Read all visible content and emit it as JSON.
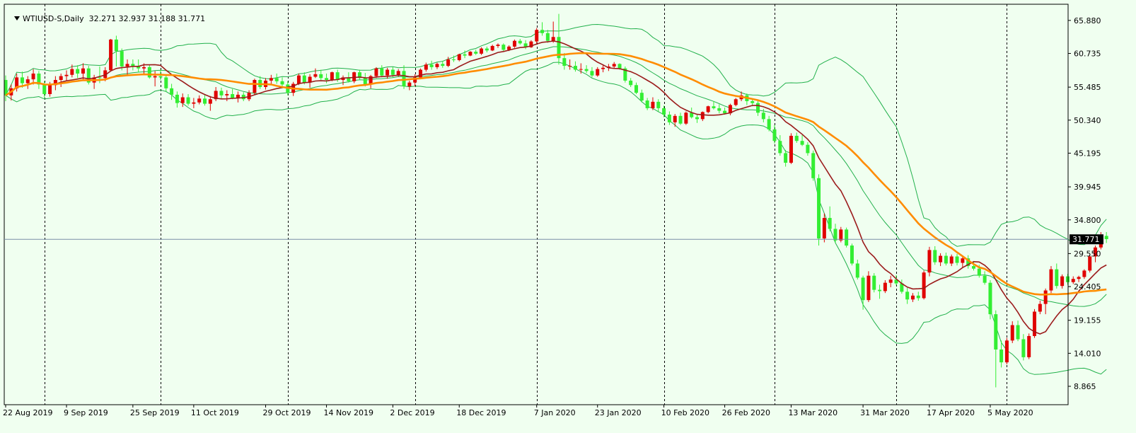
{
  "chart_data": {
    "type": "candlestick",
    "title": "WTIUSD-S,Daily",
    "ohlc_label": "32.271 32.937 31.188 31.771",
    "last_price": "31.771",
    "price_ticks": [
      "65.880",
      "60.735",
      "55.485",
      "50.340",
      "45.195",
      "39.945",
      "34.800",
      "29.550",
      "24.405",
      "19.155",
      "14.010",
      "8.865"
    ],
    "date_labels": [
      "22 Aug 2019",
      "9 Sep 2019",
      "25 Sep 2019",
      "11 Oct 2019",
      "29 Oct 2019",
      "14 Nov 2019",
      "2 Dec 2019",
      "18 Dec 2019",
      "7 Jan 2020",
      "23 Jan 2020",
      "10 Feb 2020",
      "26 Feb 2020",
      "13 Mar 2020",
      "31 Mar 2020",
      "17 Apr 2020",
      "5 May 2020"
    ],
    "period_separators": [
      "Sep 2019",
      "Oct 2019",
      "Nov 2019",
      "Dec 2019",
      "Jan 2020",
      "Feb 2020",
      "Mar 2020",
      "Apr 2020",
      "May 2020"
    ],
    "ylim": [
      6.0,
      68.4
    ],
    "indicators": [
      {
        "name": "Bollinger Bands",
        "color": "#22b14c"
      },
      {
        "name": "MA fast",
        "color": "#9b1b1b"
      },
      {
        "name": "MA slow",
        "color": "#ff8c00"
      }
    ],
    "colors": {
      "bull": "#e00000",
      "bear": "#33ee33",
      "grid": "#000000",
      "background": "#f0fff0"
    },
    "candles": [
      [
        56.6,
        57.3,
        53.3,
        54.2
      ],
      [
        54.2,
        55.9,
        53.4,
        55.3
      ],
      [
        55.3,
        57.6,
        54.8,
        57.0
      ],
      [
        57.0,
        57.9,
        55.4,
        56.1
      ],
      [
        56.1,
        57.2,
        55.2,
        56.7
      ],
      [
        56.7,
        58.3,
        55.9,
        57.6
      ],
      [
        57.6,
        58.0,
        55.2,
        55.9
      ],
      [
        55.9,
        56.4,
        53.8,
        54.4
      ],
      [
        54.4,
        56.3,
        54.0,
        55.8
      ],
      [
        55.8,
        57.2,
        55.0,
        56.6
      ],
      [
        56.6,
        57.6,
        55.5,
        57.2
      ],
      [
        57.2,
        58.1,
        56.4,
        57.4
      ],
      [
        57.4,
        59.0,
        57.0,
        58.3
      ],
      [
        58.3,
        58.9,
        56.9,
        57.6
      ],
      [
        57.6,
        59.2,
        56.5,
        58.4
      ],
      [
        58.4,
        58.8,
        55.9,
        56.2
      ],
      [
        56.2,
        57.4,
        55.2,
        57.0
      ],
      [
        57.0,
        58.7,
        56.1,
        56.9
      ],
      [
        56.9,
        58.6,
        56.4,
        58.1
      ],
      [
        58.1,
        63.0,
        58.0,
        62.9
      ],
      [
        62.9,
        63.5,
        58.7,
        61.1
      ],
      [
        61.1,
        61.5,
        58.1,
        58.7
      ],
      [
        58.7,
        59.8,
        57.2,
        59.1
      ],
      [
        59.1,
        59.8,
        58.1,
        58.8
      ],
      [
        58.8,
        59.8,
        57.8,
        58.4
      ],
      [
        58.4,
        59.2,
        57.4,
        58.6
      ],
      [
        58.6,
        59.0,
        56.8,
        57.0
      ],
      [
        57.0,
        58.0,
        55.6,
        57.2
      ],
      [
        57.2,
        58.2,
        56.6,
        57.0
      ],
      [
        57.0,
        57.5,
        54.8,
        55.3
      ],
      [
        55.3,
        56.0,
        53.5,
        54.3
      ],
      [
        54.3,
        54.8,
        52.3,
        53.0
      ],
      [
        53.0,
        54.5,
        52.4,
        53.9
      ],
      [
        53.9,
        54.4,
        52.6,
        52.9
      ],
      [
        52.9,
        53.8,
        52.2,
        53.1
      ],
      [
        53.1,
        54.2,
        52.8,
        53.7
      ],
      [
        53.7,
        54.3,
        52.6,
        52.9
      ],
      [
        52.9,
        54.1,
        51.8,
        53.6
      ],
      [
        53.6,
        55.5,
        53.3,
        54.9
      ],
      [
        54.9,
        55.4,
        53.7,
        54.2
      ],
      [
        54.2,
        55.0,
        53.3,
        54.4
      ],
      [
        54.4,
        55.2,
        53.6,
        53.8
      ],
      [
        53.8,
        54.8,
        53.1,
        54.3
      ],
      [
        54.3,
        54.7,
        53.3,
        53.6
      ],
      [
        53.6,
        55.0,
        53.3,
        54.6
      ],
      [
        54.6,
        56.8,
        54.3,
        56.6
      ],
      [
        56.6,
        57.2,
        55.2,
        55.5
      ],
      [
        55.5,
        56.9,
        55.1,
        56.5
      ],
      [
        56.5,
        57.4,
        55.8,
        56.9
      ],
      [
        56.9,
        57.6,
        56.0,
        56.4
      ],
      [
        56.4,
        57.0,
        55.3,
        55.9
      ],
      [
        55.9,
        56.4,
        54.2,
        54.6
      ],
      [
        54.6,
        56.3,
        54.1,
        56.0
      ],
      [
        56.0,
        57.6,
        55.8,
        57.3
      ],
      [
        57.3,
        57.8,
        55.9,
        56.2
      ],
      [
        56.2,
        57.5,
        55.4,
        57.1
      ],
      [
        57.1,
        58.4,
        56.9,
        57.5
      ],
      [
        57.5,
        58.2,
        56.6,
        56.9
      ],
      [
        56.9,
        57.6,
        56.1,
        56.6
      ],
      [
        56.6,
        57.9,
        56.4,
        57.8
      ],
      [
        57.8,
        58.2,
        56.3,
        56.6
      ],
      [
        56.6,
        57.3,
        55.8,
        57.0
      ],
      [
        57.0,
        57.8,
        56.2,
        56.4
      ],
      [
        56.4,
        57.9,
        56.1,
        57.8
      ],
      [
        57.8,
        58.2,
        56.6,
        56.9
      ],
      [
        56.9,
        57.7,
        55.6,
        55.9
      ],
      [
        55.9,
        57.4,
        55.3,
        57.2
      ],
      [
        57.2,
        58.6,
        56.9,
        58.4
      ],
      [
        58.4,
        58.9,
        57.0,
        57.3
      ],
      [
        57.3,
        58.5,
        56.8,
        58.2
      ],
      [
        58.2,
        58.6,
        57.0,
        57.4
      ],
      [
        57.4,
        58.3,
        57.1,
        58.0
      ],
      [
        58.0,
        58.9,
        55.2,
        55.6
      ],
      [
        55.6,
        56.5,
        55.0,
        56.2
      ],
      [
        56.2,
        57.5,
        55.6,
        57.0
      ],
      [
        57.0,
        58.4,
        56.8,
        58.2
      ],
      [
        58.2,
        59.3,
        57.9,
        59.0
      ],
      [
        59.0,
        59.6,
        58.2,
        58.6
      ],
      [
        58.6,
        59.3,
        58.3,
        59.1
      ],
      [
        59.1,
        59.6,
        58.5,
        58.8
      ],
      [
        58.8,
        60.2,
        58.6,
        59.8
      ],
      [
        59.8,
        60.4,
        59.4,
        59.7
      ],
      [
        59.7,
        60.7,
        59.5,
        60.6
      ],
      [
        60.6,
        61.2,
        60.0,
        60.4
      ],
      [
        60.4,
        61.1,
        60.3,
        61.0
      ],
      [
        61.0,
        61.3,
        60.5,
        60.7
      ],
      [
        60.7,
        61.7,
        60.5,
        61.5
      ],
      [
        61.5,
        61.8,
        60.9,
        61.2
      ],
      [
        61.2,
        62.1,
        61.1,
        61.9
      ],
      [
        61.9,
        62.3,
        61.6,
        62.1
      ],
      [
        62.1,
        62.3,
        61.1,
        61.3
      ],
      [
        61.3,
        62.0,
        61.1,
        61.8
      ],
      [
        61.8,
        62.9,
        61.6,
        62.7
      ],
      [
        62.7,
        63.0,
        62.1,
        62.3
      ],
      [
        62.3,
        62.8,
        61.4,
        61.7
      ],
      [
        61.7,
        62.8,
        61.6,
        62.6
      ],
      [
        62.6,
        64.7,
        62.1,
        64.4
      ],
      [
        64.4,
        65.6,
        63.5,
        63.9
      ],
      [
        63.9,
        64.4,
        62.4,
        62.7
      ],
      [
        62.7,
        65.7,
        62.4,
        63.3
      ],
      [
        63.3,
        66.9,
        59.0,
        60.0
      ],
      [
        60.0,
        60.8,
        58.2,
        58.8
      ],
      [
        58.8,
        59.8,
        58.2,
        58.8
      ],
      [
        58.8,
        59.5,
        57.9,
        58.2
      ],
      [
        58.2,
        59.2,
        57.6,
        58.3
      ],
      [
        58.3,
        58.9,
        57.7,
        58.0
      ],
      [
        58.0,
        58.6,
        57.0,
        57.3
      ],
      [
        57.3,
        58.6,
        57.1,
        58.3
      ],
      [
        58.3,
        59.0,
        57.8,
        58.5
      ],
      [
        58.5,
        59.1,
        58.0,
        58.7
      ],
      [
        58.7,
        59.4,
        58.4,
        59.1
      ],
      [
        59.1,
        59.2,
        58.2,
        58.4
      ],
      [
        58.4,
        58.7,
        56.2,
        56.5
      ],
      [
        56.5,
        56.9,
        55.5,
        55.8
      ],
      [
        55.8,
        56.2,
        54.4,
        54.6
      ],
      [
        54.6,
        55.1,
        53.1,
        53.4
      ],
      [
        53.4,
        53.8,
        51.9,
        52.2
      ],
      [
        52.2,
        53.9,
        51.9,
        53.2
      ],
      [
        53.2,
        53.6,
        51.7,
        52.2
      ],
      [
        52.2,
        52.6,
        50.8,
        51.2
      ],
      [
        51.2,
        51.7,
        49.6,
        50.0
      ],
      [
        50.0,
        51.3,
        49.3,
        51.0
      ],
      [
        51.0,
        51.5,
        49.6,
        49.8
      ],
      [
        49.8,
        51.7,
        49.6,
        51.5
      ],
      [
        51.5,
        52.3,
        50.6,
        50.8
      ],
      [
        50.8,
        51.2,
        49.9,
        50.5
      ],
      [
        50.5,
        51.7,
        50.2,
        51.6
      ],
      [
        51.6,
        52.6,
        51.4,
        52.5
      ],
      [
        52.5,
        53.3,
        52.0,
        52.2
      ],
      [
        52.2,
        52.8,
        51.4,
        51.8
      ],
      [
        51.8,
        52.3,
        51.2,
        51.4
      ],
      [
        51.4,
        52.9,
        51.1,
        52.7
      ],
      [
        52.7,
        53.8,
        52.5,
        53.6
      ],
      [
        53.6,
        54.8,
        53.3,
        54.2
      ],
      [
        54.2,
        54.5,
        52.7,
        53.3
      ],
      [
        53.3,
        53.7,
        52.5,
        53.0
      ],
      [
        53.0,
        53.3,
        51.0,
        51.5
      ],
      [
        51.5,
        52.1,
        50.0,
        50.5
      ],
      [
        50.5,
        51.0,
        48.6,
        48.9
      ],
      [
        48.9,
        49.6,
        46.7,
        47.1
      ],
      [
        47.1,
        48.0,
        44.8,
        45.2
      ],
      [
        45.2,
        45.7,
        43.1,
        43.7
      ],
      [
        43.7,
        48.3,
        43.5,
        47.9
      ],
      [
        47.9,
        48.4,
        46.8,
        47.1
      ],
      [
        47.1,
        48.0,
        46.3,
        46.5
      ],
      [
        46.5,
        46.9,
        44.8,
        45.2
      ],
      [
        45.2,
        45.6,
        40.9,
        41.3
      ],
      [
        41.3,
        41.9,
        30.8,
        31.9
      ],
      [
        31.9,
        35.8,
        31.3,
        35.1
      ],
      [
        35.1,
        36.9,
        33.0,
        33.4
      ],
      [
        33.4,
        34.2,
        31.2,
        31.6
      ],
      [
        31.6,
        33.7,
        31.3,
        33.3
      ],
      [
        33.3,
        33.6,
        30.5,
        30.8
      ],
      [
        30.8,
        31.1,
        27.7,
        28.0
      ],
      [
        28.0,
        28.6,
        25.5,
        25.8
      ],
      [
        25.8,
        26.1,
        20.8,
        22.3
      ],
      [
        22.3,
        26.8,
        22.0,
        26.1
      ],
      [
        26.1,
        26.5,
        23.5,
        23.9
      ],
      [
        23.9,
        24.7,
        22.5,
        23.7
      ],
      [
        23.7,
        25.4,
        23.4,
        25.0
      ],
      [
        25.0,
        26.1,
        24.3,
        25.5
      ],
      [
        25.5,
        26.2,
        24.6,
        24.9
      ],
      [
        24.9,
        25.5,
        23.3,
        23.6
      ],
      [
        23.6,
        24.2,
        21.7,
        22.4
      ],
      [
        22.4,
        23.4,
        22.0,
        23.0
      ],
      [
        23.0,
        23.6,
        22.2,
        22.6
      ],
      [
        22.6,
        26.9,
        22.4,
        26.6
      ],
      [
        26.6,
        30.6,
        26.0,
        30.1
      ],
      [
        30.1,
        30.7,
        27.8,
        28.2
      ],
      [
        28.2,
        29.6,
        27.6,
        29.2
      ],
      [
        29.2,
        29.7,
        27.7,
        28.0
      ],
      [
        28.0,
        29.4,
        27.6,
        29.1
      ],
      [
        29.1,
        29.5,
        27.7,
        28.1
      ],
      [
        28.1,
        29.2,
        27.4,
        28.8
      ],
      [
        28.8,
        29.3,
        27.2,
        27.6
      ],
      [
        27.6,
        28.4,
        26.9,
        27.2
      ],
      [
        27.2,
        27.8,
        25.8,
        26.1
      ],
      [
        26.1,
        26.8,
        24.7,
        25.0
      ],
      [
        25.0,
        25.4,
        19.3,
        20.1
      ],
      [
        20.1,
        20.7,
        8.7,
        14.6
      ],
      [
        14.6,
        16.0,
        11.8,
        12.6
      ],
      [
        12.6,
        16.4,
        12.3,
        16.0
      ],
      [
        16.0,
        19.0,
        15.6,
        18.4
      ],
      [
        18.4,
        19.1,
        15.9,
        16.2
      ],
      [
        16.2,
        17.0,
        12.9,
        13.4
      ],
      [
        13.4,
        17.1,
        13.1,
        16.7
      ],
      [
        16.7,
        20.9,
        16.4,
        20.5
      ],
      [
        20.5,
        22.2,
        20.1,
        21.7
      ],
      [
        21.7,
        24.1,
        20.1,
        23.8
      ],
      [
        23.8,
        27.6,
        23.4,
        27.1
      ],
      [
        27.1,
        28.0,
        24.1,
        24.5
      ],
      [
        24.5,
        26.3,
        24.1,
        26.0
      ],
      [
        26.0,
        26.4,
        24.7,
        25.1
      ],
      [
        25.1,
        26.0,
        24.8,
        25.6
      ],
      [
        25.6,
        26.1,
        25.1,
        25.9
      ],
      [
        25.9,
        27.1,
        25.6,
        26.9
      ],
      [
        26.9,
        29.4,
        26.6,
        29.1
      ],
      [
        29.1,
        30.8,
        28.2,
        30.5
      ],
      [
        30.5,
        32.9,
        30.2,
        32.3
      ],
      [
        32.3,
        32.9,
        31.2,
        31.8
      ]
    ]
  }
}
